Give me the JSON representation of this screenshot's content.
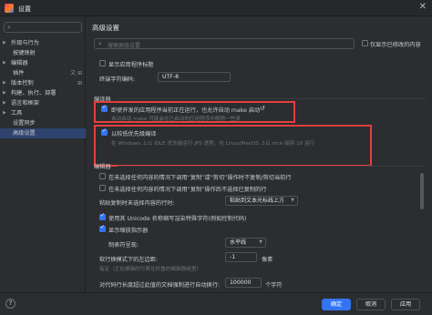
{
  "window": {
    "title": "设置"
  },
  "sidebar": {
    "items": [
      {
        "label": "外观与行为"
      },
      {
        "label": "按键映射"
      },
      {
        "label": "编辑器"
      },
      {
        "label": "插件"
      },
      {
        "label": "版本控制"
      },
      {
        "label": "构建、执行、部署"
      },
      {
        "label": "语言和框架"
      },
      {
        "label": "工具"
      },
      {
        "label": "设置同步"
      },
      {
        "label": "高级设置"
      }
    ]
  },
  "main": {
    "title": "高级设置",
    "search_placeholder": "搜索高级设置",
    "only_modified_label": "仅显示已修改的内容",
    "show_app_title": "显示应用程序标题",
    "terminal_encoding_label": "终端字符编码:",
    "terminal_encoding_value": "UTF-8",
    "compiler_section": "编译器",
    "auto_make_label": "即使开发的应用程序当前正在运行，也允许自动 make 启动",
    "auto_make_hint": "自动启动 make 可能会在已启动的应用程序中删除一些类",
    "low_priority_label": "以较低优先级编译",
    "low_priority_hint": "在 Windows 上以 IDLE 优先级运行 JPS 进程，在 Linux/MacOS 上以 nice 级别 10 运行",
    "editor_section": "编辑器",
    "editor_opt1": "在未选择任何内容的情况下调用“复制”或“剪切”操作时不复制/剪切当前行",
    "editor_opt2": "在未选择任何内容的情况下调用“复制”操作后不选择已复制的行",
    "paste_label": "粘贴复制时未选择内容的行时:",
    "paste_value": "粘贴到文本光标线上方",
    "unicode_label": "使用其 Unicode 名称缩写渲染特殊字符(例如控制代码)",
    "show_indent_label": "显示缩放指示器",
    "tab_render_label": "制表符呈现:",
    "tab_render_value": "水平线",
    "soft_wrap_indent_label": "软行换模式下的左边距:",
    "soft_wrap_indent_value": "-1",
    "soft_wrap_unit": "像素",
    "soft_wrap_hint": "指定（正在编辑的行首在折叠的编辑器组里）",
    "long_line_label": "对代码行长度超过此值的文档强制进行自动换行:",
    "long_line_value": "100000",
    "long_line_unit": "个字符"
  },
  "footer": {
    "help": "?",
    "ok": "确定",
    "cancel": "取消",
    "apply": "应用"
  }
}
